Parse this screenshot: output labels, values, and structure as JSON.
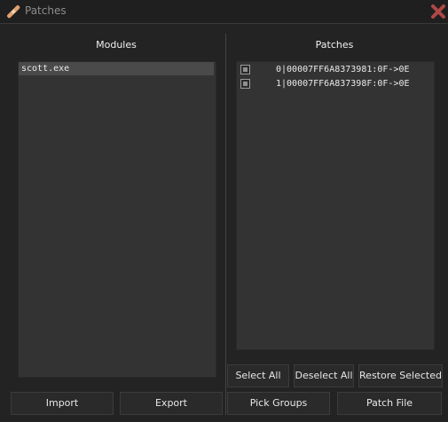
{
  "window": {
    "title": "Patches"
  },
  "modules": {
    "title": "Modules",
    "items": [
      "scott.exe"
    ]
  },
  "patches": {
    "title": "Patches",
    "items": [
      "0|00007FF6A8373981:0F->0E",
      "1|00007FF6A837398F:0F->0E"
    ]
  },
  "buttons": {
    "import": "Import",
    "export": "Export",
    "select_all": "Select All",
    "deselect_all": "Deselect All",
    "restore_selected": "Restore Selected",
    "pick_groups": "Pick Groups",
    "patch_file": "Patch File"
  },
  "colors": {
    "close_icon": "#b04848",
    "title_icon": "#e0a070"
  }
}
